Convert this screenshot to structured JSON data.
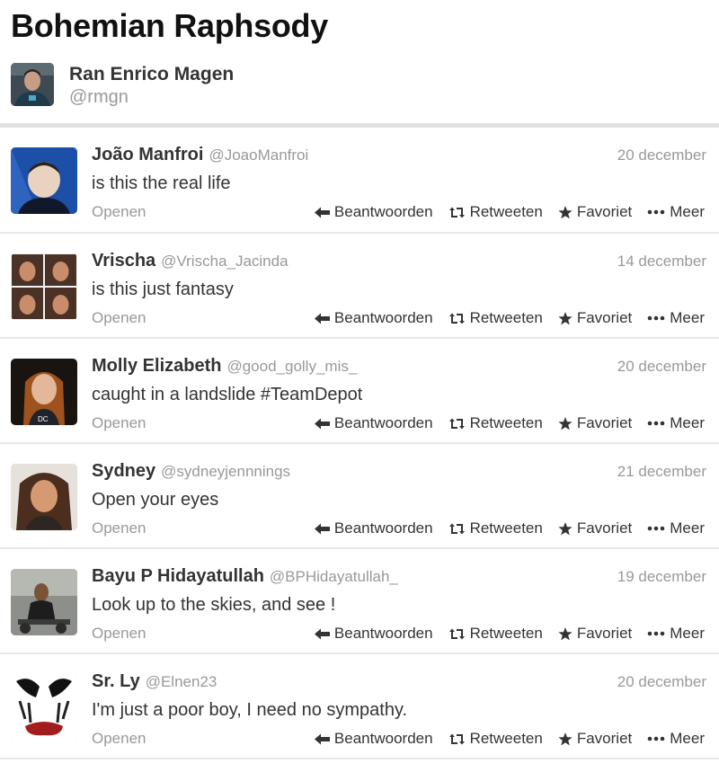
{
  "list": {
    "title": "Bohemian Raphsody"
  },
  "owner": {
    "name": "Ran Enrico Magen",
    "handle": "@rmgn"
  },
  "actions": {
    "open": "Openen",
    "reply": "Beantwoorden",
    "retweet": "Retweeten",
    "favorite": "Favoriet",
    "more": "Meer"
  },
  "icons": {
    "reply": "reply-arrow-icon",
    "retweet": "retweet-icon",
    "favorite": "star-icon",
    "more": "more-dots-icon"
  },
  "colors": {
    "text": "#333333",
    "muted": "#999999",
    "divider": "#e1e1e1"
  },
  "tweets": [
    {
      "name": "João Manfroi",
      "handle": "@JoaoManfroi",
      "date": "20 december",
      "text": "is this the real life"
    },
    {
      "name": "Vrischa",
      "handle": "@Vrischa_Jacinda",
      "date": "14 december",
      "text": "is this just fantasy"
    },
    {
      "name": "Molly Elizabeth",
      "handle": "@good_golly_mis_",
      "date": "20 december",
      "text": "caught in a landslide  #TeamDepot"
    },
    {
      "name": "Sydney",
      "handle": "@sydneyjennnings",
      "date": "21 december",
      "text": "Open your eyes"
    },
    {
      "name": "Bayu P Hidayatullah",
      "handle": "@BPHidayatullah_",
      "date": "19 december",
      "text": "Look up to the skies, and see !"
    },
    {
      "name": "Sr. Ly",
      "handle": "@Elnen23",
      "date": "20 december",
      "text": "I'm just a poor boy, I need no sympathy."
    }
  ]
}
